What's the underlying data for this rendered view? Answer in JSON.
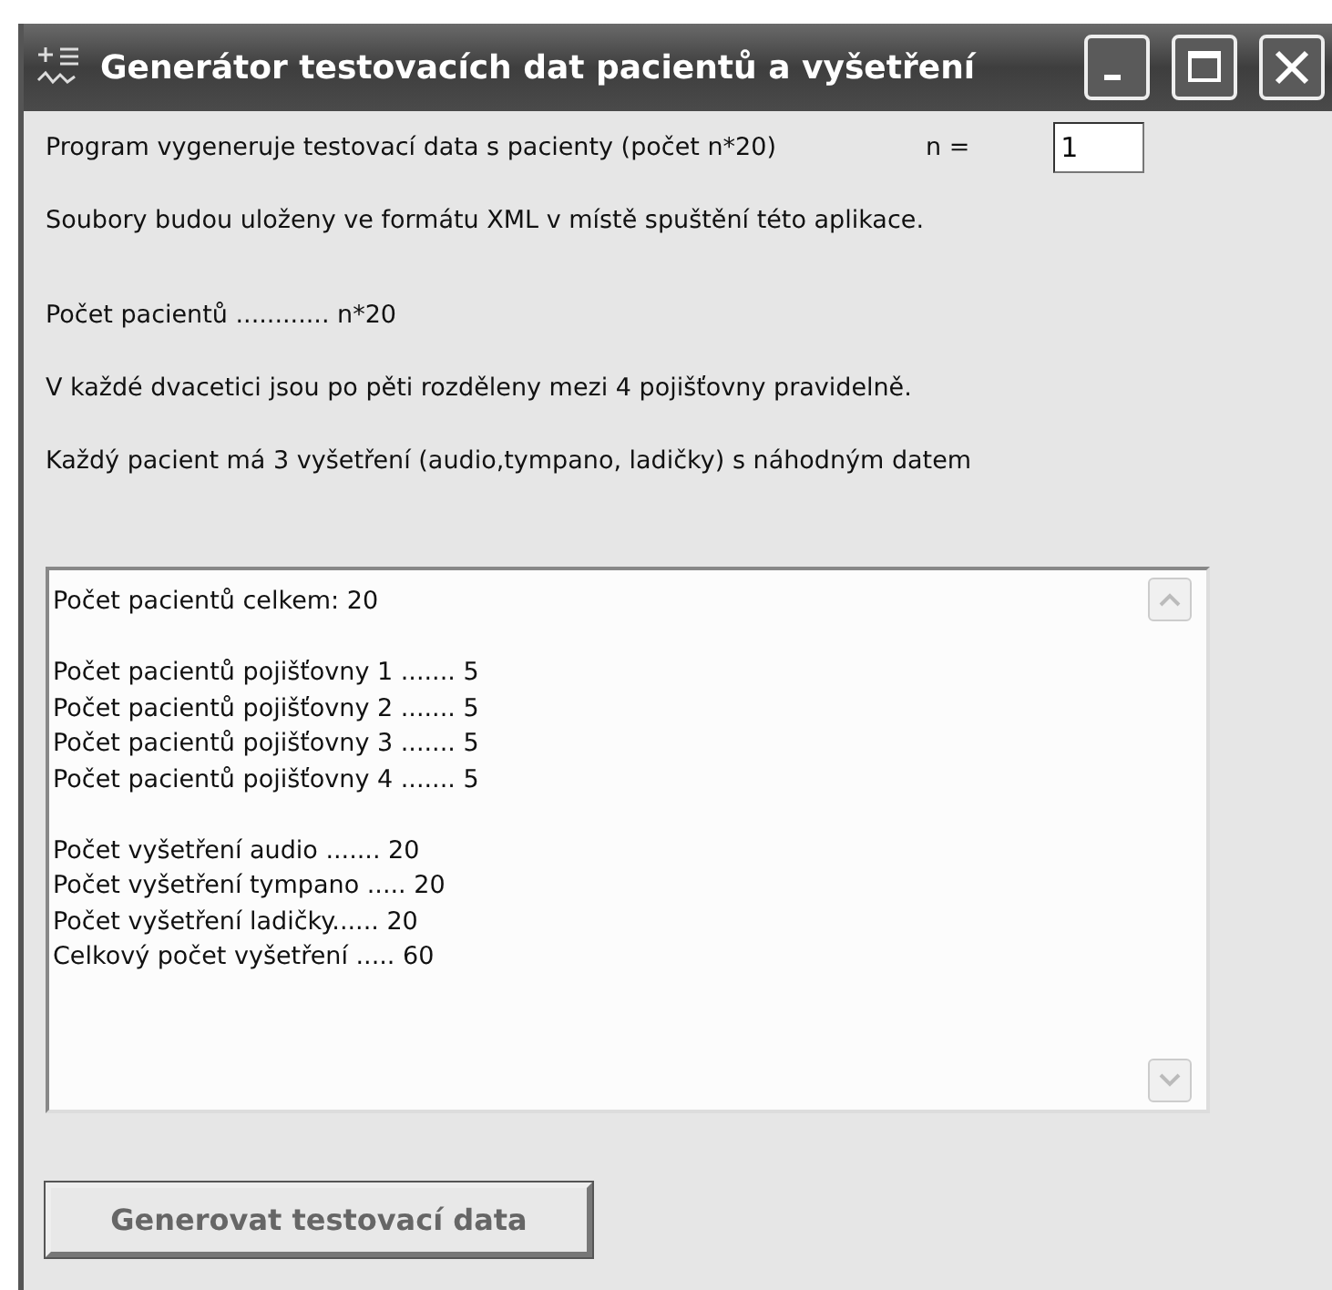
{
  "window": {
    "title": "Generátor testovacích dat pacientů a vyšetření"
  },
  "intro": {
    "text": "Program vygeneruje testovací data s pacienty (počet n*20)",
    "n_label": "n =",
    "n_value": "1"
  },
  "info_lines": [
    "Soubory budou uloženy ve formátu XML v místě spuštění této aplikace.",
    "Počet pacientů ............  n*20",
    "V každé dvacetici jsou po pěti rozděleny mezi 4 pojišťovny pravidelně.",
    "Každý pacient má 3 vyšetření (audio,tympano, ladičky) s náhodným datem"
  ],
  "output": {
    "groups": [
      [
        "Počet pacientů celkem: 20"
      ],
      [
        "Počet pacientů pojišťovny 1 ....... 5",
        "Počet pacientů pojišťovny 2 ....... 5",
        "Počet pacientů pojišťovny 3 ....... 5",
        "Počet pacientů pojišťovny 4 ....... 5"
      ],
      [
        "Počet vyšetření audio ....... 20",
        "Počet vyšetření tympano ..... 20",
        "Počet vyšetření ladičky...... 20",
        "Celkový počet vyšetření ..... 60"
      ]
    ]
  },
  "generate_button": {
    "label": "Generovat testovací data",
    "disabled": true
  }
}
